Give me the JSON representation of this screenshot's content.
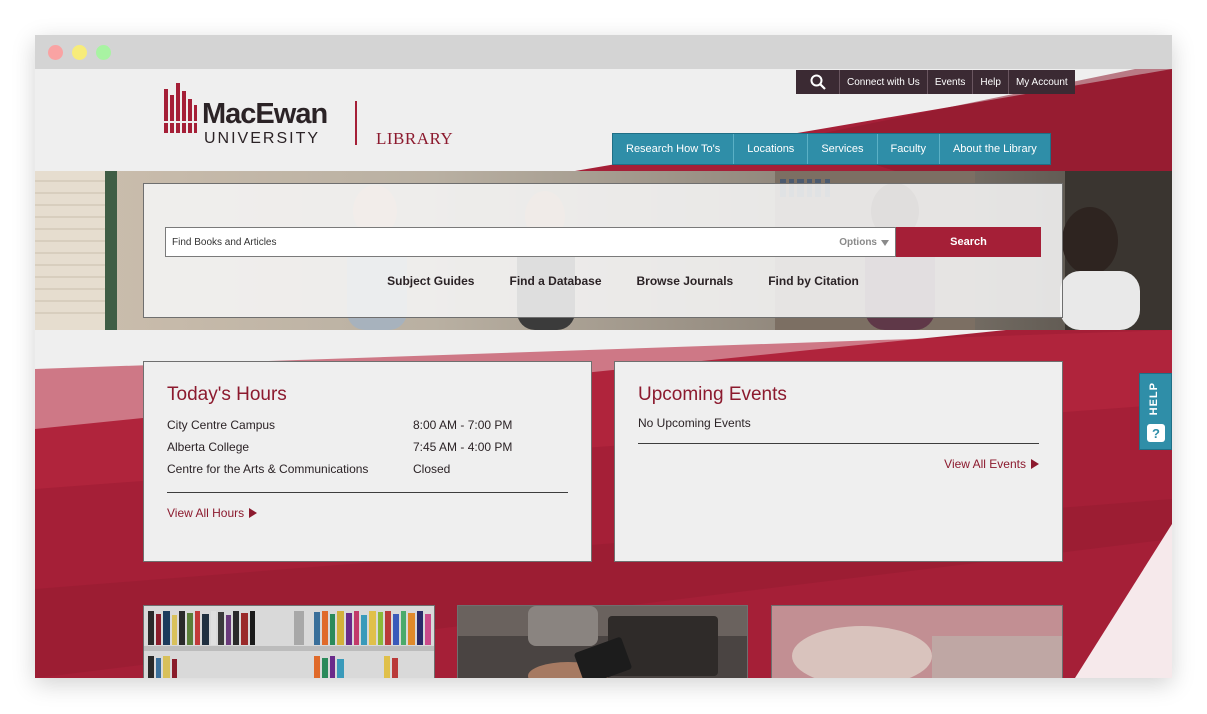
{
  "browser": {
    "window_controls": [
      "close",
      "minimize",
      "maximize"
    ]
  },
  "brand": {
    "name": "MacEwan",
    "university": "UNIVERSITY",
    "library": "LIBRARY",
    "primary_color": "#a51f37",
    "accent_color": "#2f8ea8",
    "dark_color": "#3b2a33"
  },
  "utility_nav": {
    "search_icon": "search-icon",
    "links": [
      "Connect with Us",
      "Events",
      "Help",
      "My Account"
    ]
  },
  "main_nav": {
    "items": [
      "Research How To's",
      "Locations",
      "Services",
      "Faculty",
      "About the Library"
    ]
  },
  "search": {
    "placeholder": "Find Books and Articles",
    "options_label": "Options",
    "button_label": "Search",
    "quick_links": [
      "Subject Guides",
      "Find a Database",
      "Browse Journals",
      "Find by Citation"
    ]
  },
  "hours": {
    "title": "Today's Hours",
    "rows": [
      {
        "campus": "City Centre Campus",
        "time": "8:00 AM - 7:00 PM"
      },
      {
        "campus": "Alberta College",
        "time": "7:45 AM - 4:00 PM"
      },
      {
        "campus": "Centre for the Arts & Communications",
        "time": "Closed"
      }
    ],
    "link_label": "View All Hours"
  },
  "events": {
    "title": "Upcoming Events",
    "empty_message": "No Upcoming Events",
    "link_label": "View All Events"
  },
  "help_tab": {
    "label": "HELP",
    "icon_glyph": "?"
  }
}
